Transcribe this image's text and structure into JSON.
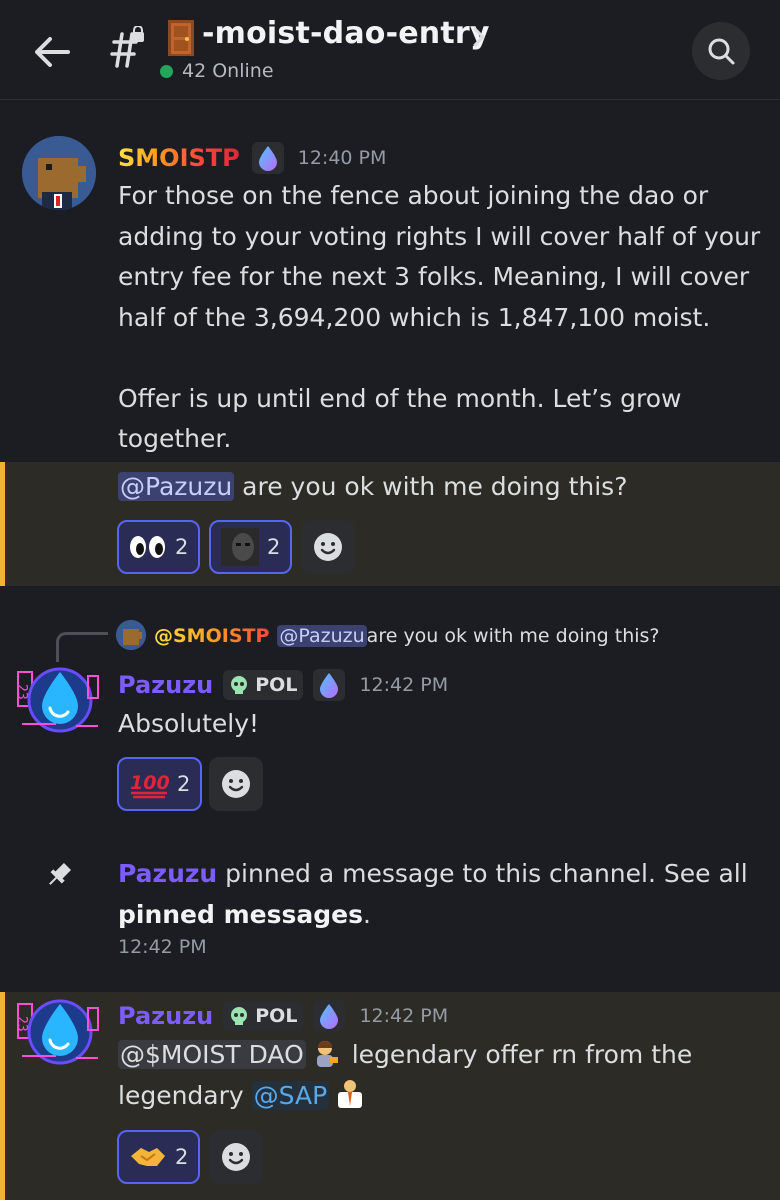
{
  "header": {
    "channel_name": "-moist-dao-entry",
    "online_count": "42 Online"
  },
  "messages": [
    {
      "author": "SMOISTP",
      "time": "12:40 PM",
      "lines": [
        "For those on the fence about joining the dao or",
        "adding to your voting rights I will cover half of your",
        "entry fee for the next 3 folks. Meaning, I will cover",
        "half of the 3,694,200 which is 1,847,100 moist.",
        "Offer is up until end of the month. Let’s grow",
        "together."
      ],
      "mention": "@Pazuzu",
      "mention_tail": " are you ok with me doing this?",
      "reactions": [
        {
          "icon": "eyes-emoji",
          "count": "2"
        },
        {
          "icon": "custom-face-emoji",
          "count": "2"
        }
      ]
    },
    {
      "reply": {
        "author": "@SMOISTP",
        "mention": "@Pazuzu",
        "text": " are you ok with me doing this?"
      },
      "author": "Pazuzu",
      "role_tag": "POL",
      "time": "12:42 PM",
      "text": "Absolutely!",
      "reactions": [
        {
          "icon": "hundred-emoji",
          "count": "2"
        }
      ]
    },
    {
      "system": true,
      "author": "Pazuzu",
      "text": " pinned a message to this channel. See all",
      "bold_text": "pinned messages",
      "tail": ".",
      "time": "12:42 PM"
    },
    {
      "author": "Pazuzu",
      "role_tag": "POL",
      "time": "12:42 PM",
      "mention1": "@$MOIST DAO",
      "text1": " legendary offer rn from the",
      "text2": "legendary ",
      "mention2": "@SAP",
      "reactions": [
        {
          "icon": "handshake-emoji",
          "count": "2"
        }
      ]
    }
  ],
  "colors": {
    "background": "#1c1d22",
    "highlight": "#2c2b25",
    "highlight_bar": "#f0b232",
    "pazuzu_name": "#7c5cff",
    "online": "#23a55a",
    "reaction_border": "#5865f2"
  }
}
